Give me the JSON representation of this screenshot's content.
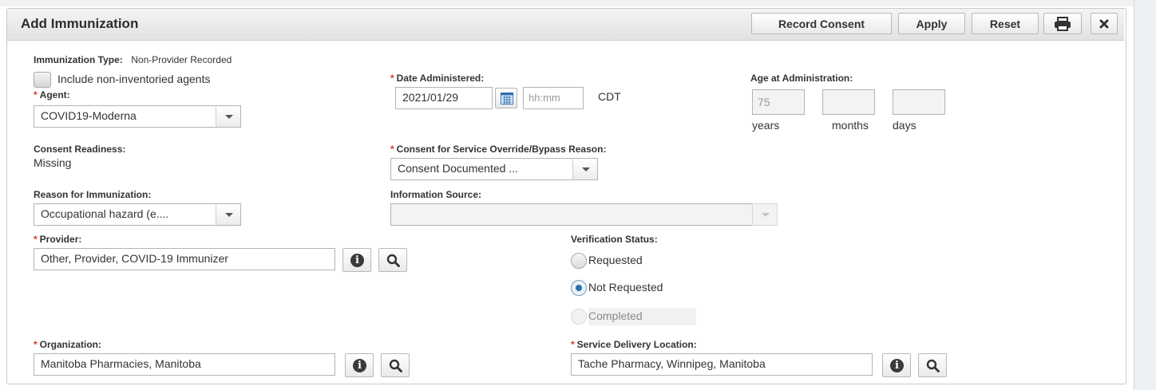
{
  "header": {
    "title": "Add Immunization",
    "buttons": {
      "record_consent": "Record Consent",
      "apply": "Apply",
      "reset": "Reset"
    }
  },
  "immunization_type": {
    "label": "Immunization Type:",
    "value": "Non-Provider Recorded"
  },
  "include_non_inventoried": {
    "label": "Include non-inventoried agents",
    "checked": false
  },
  "agent": {
    "label": "Agent:",
    "value": "COVID19-Moderna"
  },
  "date_administered": {
    "label": "Date Administered:",
    "date": "2021/01/29",
    "time_placeholder": "hh:mm",
    "timezone": "CDT"
  },
  "age_at_administration": {
    "label": "Age at Administration:",
    "years": "75",
    "months": "",
    "days": "",
    "years_label": "years",
    "months_label": "months",
    "days_label": "days"
  },
  "consent_readiness": {
    "label": "Consent Readiness:",
    "value": "Missing"
  },
  "consent_override": {
    "label": "Consent for Service Override/Bypass Reason:",
    "value": "Consent Documented ..."
  },
  "reason_for_immunization": {
    "label": "Reason for Immunization:",
    "value": "Occupational hazard (e...."
  },
  "information_source": {
    "label": "Information Source:",
    "value": ""
  },
  "provider": {
    "label": "Provider:",
    "value": "Other, Provider, COVID-19 Immunizer"
  },
  "verification_status": {
    "label": "Verification Status:",
    "options": [
      "Requested",
      "Not Requested",
      "Completed"
    ],
    "selected": "Not Requested"
  },
  "organization": {
    "label": "Organization:",
    "value": "Manitoba Pharmacies, Manitoba"
  },
  "service_delivery_location": {
    "label": "Service Delivery Location:",
    "value": "Tache Pharmacy, Winnipeg, Manitoba"
  },
  "colors": {
    "required_star": "#d9332b",
    "radio_selected": "#2e6fad",
    "header_bg": "#e9e9e9"
  },
  "icons": [
    "print-icon",
    "close-icon",
    "calendar-icon",
    "info-icon",
    "search-icon",
    "chevron-down-icon"
  ]
}
